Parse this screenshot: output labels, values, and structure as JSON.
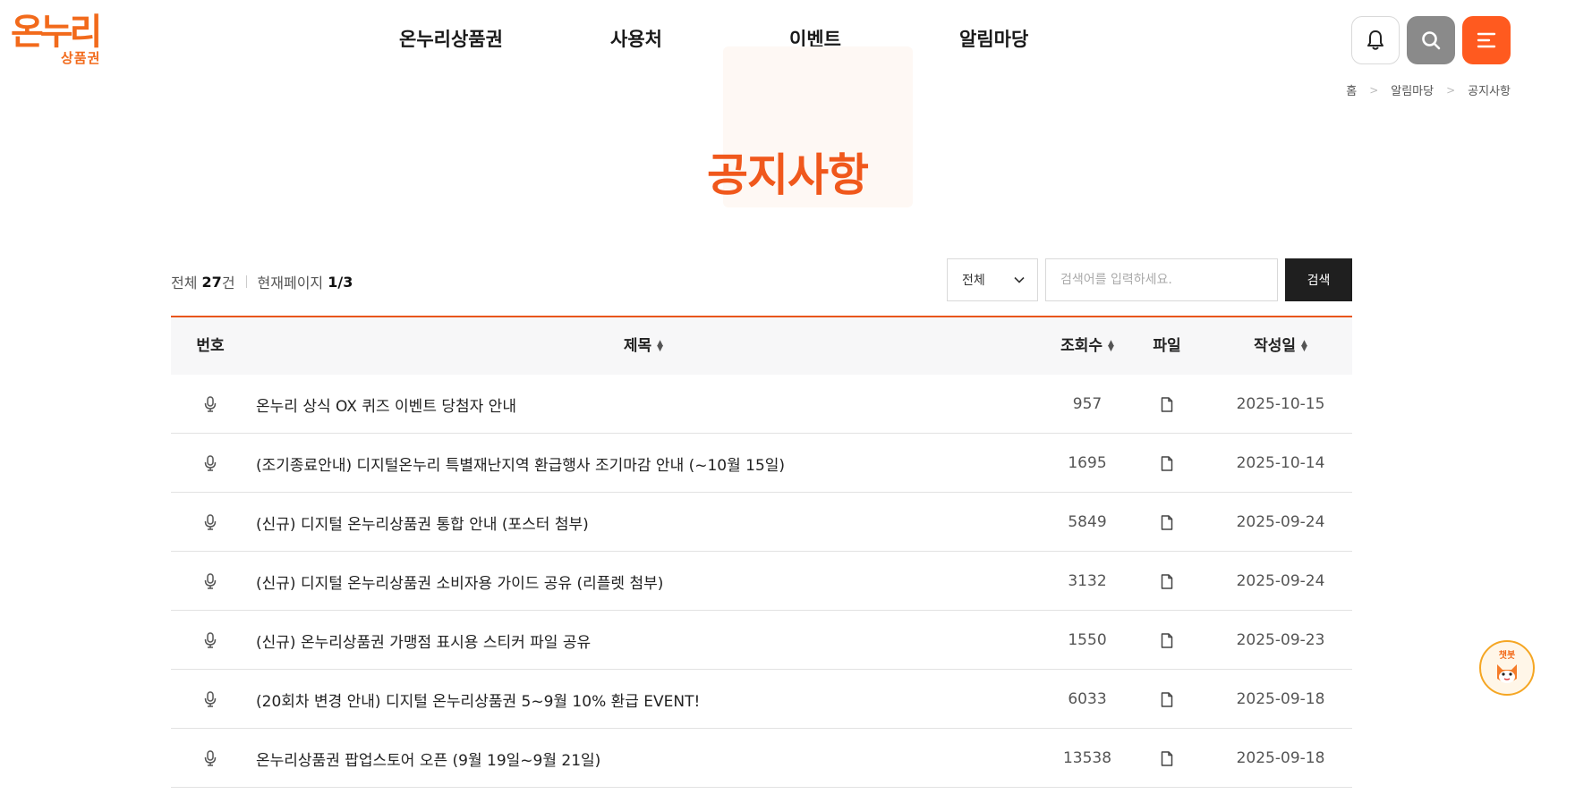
{
  "logo": {
    "main": "온누리",
    "sub": "상품권"
  },
  "nav": [
    "온누리상품권",
    "사용처",
    "이벤트",
    "알림마당"
  ],
  "breadcrumb": [
    "홈",
    "알림마당",
    "공지사항"
  ],
  "page_title": "공지사항",
  "summary": {
    "total_label": "전체",
    "total_count": "27",
    "total_unit": "건",
    "page_label": "현재페이지",
    "page_value": "1/3"
  },
  "search": {
    "filter_selected": "전체",
    "placeholder": "검색어를 입력하세요.",
    "button_label": "검색"
  },
  "table": {
    "headers": {
      "num": "번호",
      "title": "제목",
      "views": "조회수",
      "file": "파일",
      "date": "작성일"
    },
    "rows": [
      {
        "title": "온누리 상식 OX 퀴즈 이벤트 당첨자 안내",
        "views": "957",
        "date": "2025-10-15"
      },
      {
        "title": "(조기종료안내) 디지털온누리 특별재난지역 환급행사 조기마감 안내 (~10월 15일)",
        "views": "1695",
        "date": "2025-10-14"
      },
      {
        "title": "(신규) 디지털 온누리상품권 통합 안내 (포스터 첨부)",
        "views": "5849",
        "date": "2025-09-24"
      },
      {
        "title": "(신규) 디지털 온누리상품권 소비자용 가이드 공유 (리플렛 첨부)",
        "views": "3132",
        "date": "2025-09-24"
      },
      {
        "title": "(신규) 온누리상품권 가맹점 표시용 스티커 파일 공유",
        "views": "1550",
        "date": "2025-09-23"
      },
      {
        "title": "(20회차 변경 안내) 디지털 온누리상품권 5~9월 10% 환급 EVENT!",
        "views": "6033",
        "date": "2025-09-18"
      },
      {
        "title": "온누리상품권 팝업스토어 오픈 (9월 19일~9월 21일)",
        "views": "13538",
        "date": "2025-09-18"
      }
    ]
  },
  "chatbot": {
    "label": "챗봇"
  },
  "colors": {
    "brand": "#f26a1b",
    "accent": "#ff5a1f",
    "title": "#f0581c"
  },
  "icons": {
    "notice": "microphone-icon",
    "file": "file-icon"
  }
}
